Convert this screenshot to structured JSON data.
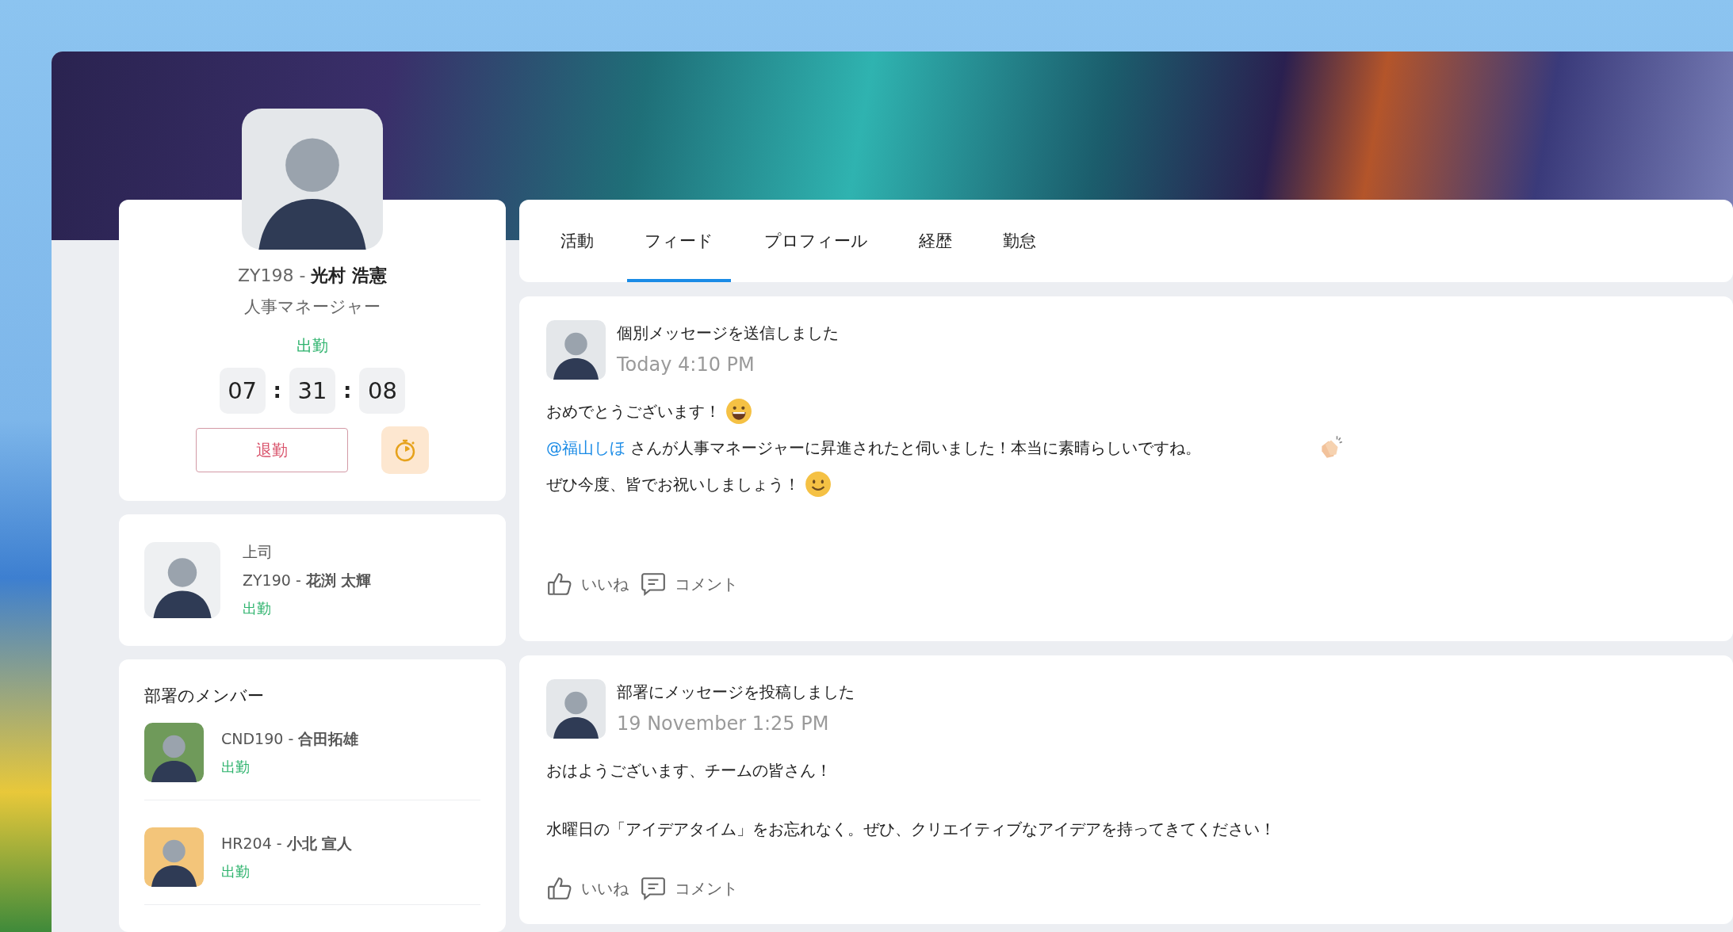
{
  "profile": {
    "code": "ZY198",
    "separator": "-",
    "name": "光村 浩憲",
    "title": "人事マネージャー",
    "status": "出勤",
    "timer": [
      {
        "kind": "digits",
        "text": "07"
      },
      {
        "kind": "separator",
        "text": ":"
      },
      {
        "kind": "digits",
        "text": "31"
      },
      {
        "kind": "separator",
        "text": ":"
      },
      {
        "kind": "digits",
        "text": "08"
      }
    ],
    "clock_out_button": "退勤"
  },
  "manager": {
    "label": "上司",
    "code": "ZY190",
    "separator": "-",
    "name": "花渕 太輝",
    "status": "出勤"
  },
  "department": {
    "title": "部署のメンバー",
    "members": [
      {
        "code": "CND190",
        "separator": "-",
        "name": "合田拓雄",
        "status": "出勤"
      },
      {
        "code": "HR204",
        "separator": "-",
        "name": "小北 宣人",
        "status": "出勤"
      }
    ]
  },
  "tabs": [
    {
      "label": "活動",
      "selected": false
    },
    {
      "label": "フィード",
      "selected": true
    },
    {
      "label": "プロフィール",
      "selected": false
    },
    {
      "label": "経歴",
      "selected": false
    },
    {
      "label": "勤怠",
      "selected": false
    }
  ],
  "posts": [
    {
      "title": "個別メッセージを送信しました",
      "time": "Today 4:10 PM",
      "paragraphs": [
        {
          "lines": [
            {
              "text": "おめでとうございます！",
              "kind": "grin"
            },
            {
              "mention": "@福山しほ",
              "text": " さんが人事マネージャーに昇進されたと伺いました！本当に素晴らしいですね。",
              "kind": "clap"
            },
            {
              "text": "ぜひ今度、皆でお祝いしましょう！",
              "kind": "smile"
            }
          ]
        }
      ],
      "like": "いいね",
      "comment": "コメント"
    },
    {
      "title": "部署にメッセージを投稿しました",
      "time": "19 November 1:25 PM",
      "paragraphs": [
        {
          "lines": [
            {
              "text": "おはようございます、チームの皆さん！",
              "kind": "plain"
            }
          ]
        },
        {
          "lines": [
            {
              "text": "水曜日の「アイデアタイム」をお忘れなく。ぜひ、クリエイティブなアイデアを持ってきてください！",
              "kind": "plain"
            }
          ]
        }
      ],
      "like": "いいね",
      "comment": "コメント"
    }
  ]
}
